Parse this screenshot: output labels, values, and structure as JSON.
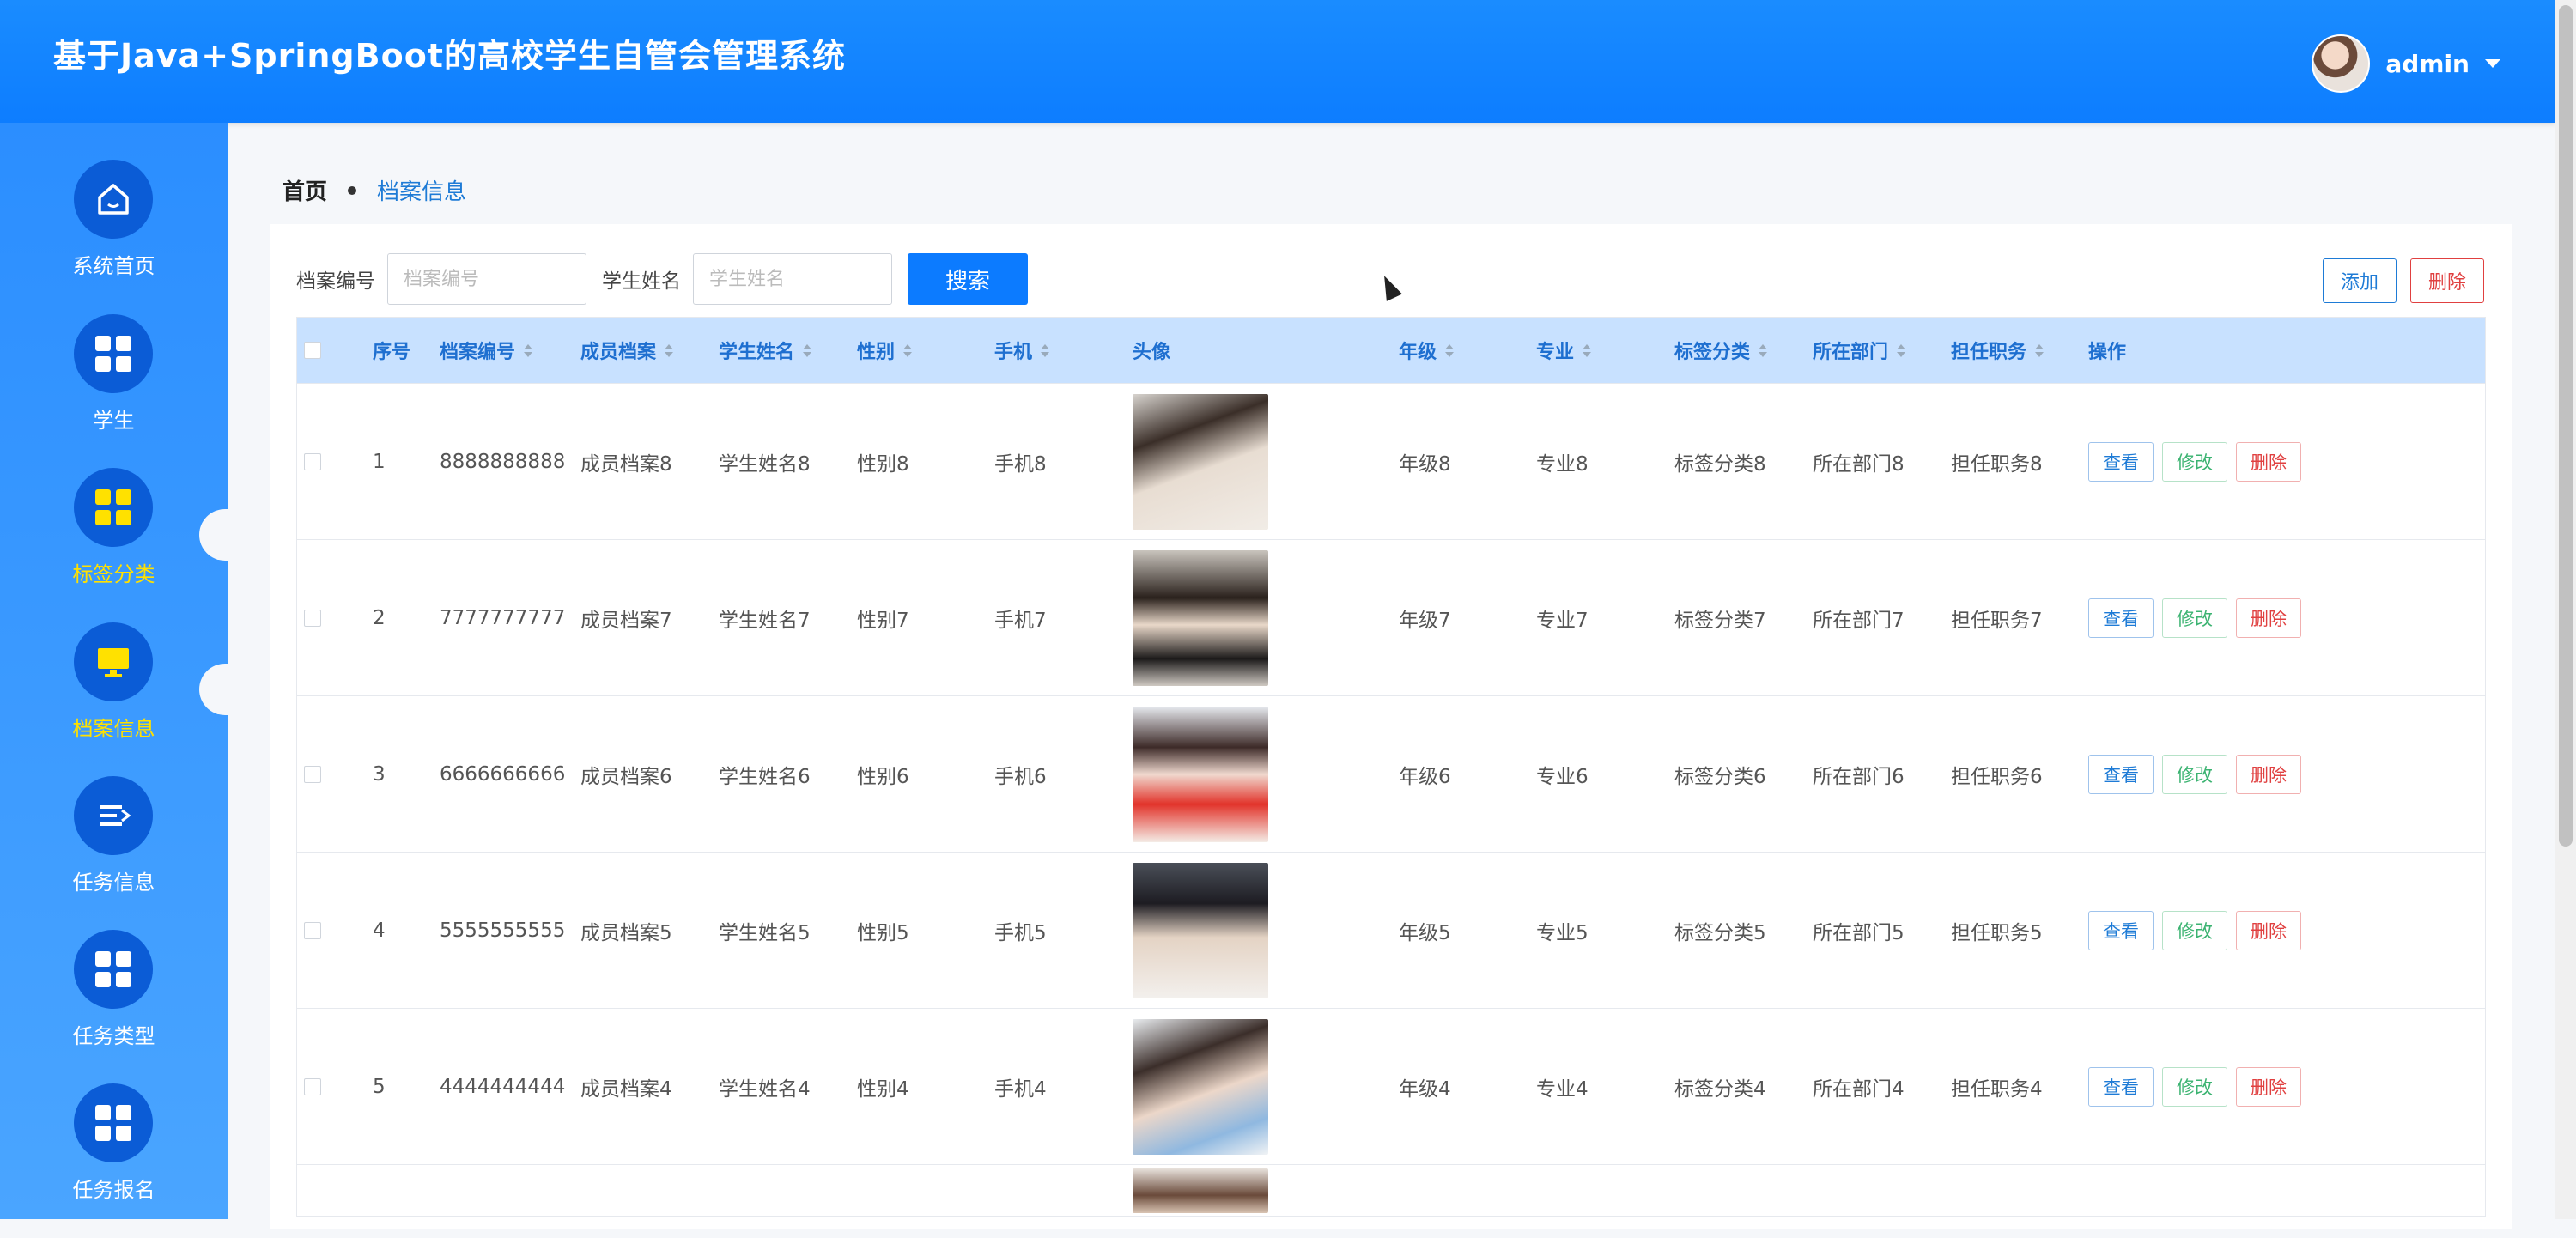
{
  "header": {
    "title": "基于Java+SpringBoot的高校学生自管会管理系统",
    "username": "admin"
  },
  "sidebar": {
    "items": [
      {
        "label": "系统首页",
        "icon": "home-icon",
        "active": false
      },
      {
        "label": "学生",
        "icon": "grid-icon",
        "active": false
      },
      {
        "label": "标签分类",
        "icon": "grid-icon",
        "active": true
      },
      {
        "label": "档案信息",
        "icon": "monitor-icon",
        "active": true
      },
      {
        "label": "任务信息",
        "icon": "list-icon",
        "active": false
      },
      {
        "label": "任务类型",
        "icon": "grid-icon",
        "active": false
      },
      {
        "label": "任务报名",
        "icon": "grid-icon",
        "active": false
      }
    ]
  },
  "breadcrumb": {
    "home": "首页",
    "current": "档案信息"
  },
  "search": {
    "field1_label": "档案编号",
    "field1_placeholder": "档案编号",
    "field2_label": "学生姓名",
    "field2_placeholder": "学生姓名",
    "button": "搜索"
  },
  "actions": {
    "add": "添加",
    "delete": "删除"
  },
  "table": {
    "headers": {
      "index": "序号",
      "file_no": "档案编号",
      "member_file": "成员档案",
      "name": "学生姓名",
      "gender": "性别",
      "phone": "手机",
      "avatar": "头像",
      "grade": "年级",
      "major": "专业",
      "tag": "标签分类",
      "dept": "所在部门",
      "duty": "担任职务",
      "ops": "操作"
    },
    "op_labels": {
      "view": "查看",
      "edit": "修改",
      "del": "删除"
    },
    "rows": [
      {
        "index": "1",
        "file_no": "8888888888",
        "member_file": "成员档案8",
        "name": "学生姓名8",
        "gender": "性别8",
        "phone": "手机8",
        "grade": "年级8",
        "major": "专业8",
        "tag": "标签分类8",
        "dept": "所在部门8",
        "duty": "担任职务8"
      },
      {
        "index": "2",
        "file_no": "7777777777",
        "member_file": "成员档案7",
        "name": "学生姓名7",
        "gender": "性别7",
        "phone": "手机7",
        "grade": "年级7",
        "major": "专业7",
        "tag": "标签分类7",
        "dept": "所在部门7",
        "duty": "担任职务7"
      },
      {
        "index": "3",
        "file_no": "6666666666",
        "member_file": "成员档案6",
        "name": "学生姓名6",
        "gender": "性别6",
        "phone": "手机6",
        "grade": "年级6",
        "major": "专业6",
        "tag": "标签分类6",
        "dept": "所在部门6",
        "duty": "担任职务6"
      },
      {
        "index": "4",
        "file_no": "5555555555",
        "member_file": "成员档案5",
        "name": "学生姓名5",
        "gender": "性别5",
        "phone": "手机5",
        "grade": "年级5",
        "major": "专业5",
        "tag": "标签分类5",
        "dept": "所在部门5",
        "duty": "担任职务5"
      },
      {
        "index": "5",
        "file_no": "4444444444",
        "member_file": "成员档案4",
        "name": "学生姓名4",
        "gender": "性别4",
        "phone": "手机4",
        "grade": "年级4",
        "major": "专业4",
        "tag": "标签分类4",
        "dept": "所在部门4",
        "duty": "担任职务4"
      }
    ]
  },
  "colors": {
    "primary": "#0c7bff",
    "header_bg": "#1a8cff",
    "active_nav": "#ffe100",
    "danger": "#e04040",
    "success": "#3bb371"
  }
}
